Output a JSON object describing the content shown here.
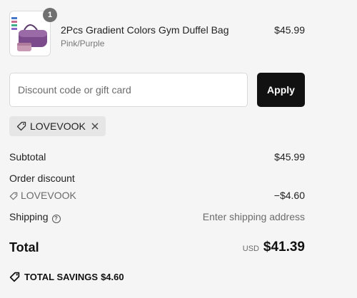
{
  "cart": {
    "item": {
      "quantity": "1",
      "name": "2Pcs Gradient Colors Gym Duffel Bag",
      "variant": "Pink/Purple",
      "price": "$45.99"
    }
  },
  "discount_form": {
    "placeholder": "Discount code or gift card",
    "apply_label": "Apply"
  },
  "applied_code": {
    "code": "LOVEVOOK"
  },
  "summary": {
    "subtotal_label": "Subtotal",
    "subtotal_value": "$45.99",
    "order_discount_label": "Order discount",
    "discount_code": "LOVEVOOK",
    "discount_value": "−$4.60",
    "shipping_label": "Shipping",
    "shipping_value": "Enter shipping address",
    "total_label": "Total",
    "currency": "USD",
    "total_value": "$41.39",
    "savings_label": "TOTAL SAVINGS",
    "savings_value": "$4.60"
  },
  "icons": {
    "tag": "tag-icon",
    "close": "close-icon",
    "help": "help-icon"
  },
  "colors": {
    "background": "#f5f5f5",
    "button": "#111111",
    "badge": "#707070",
    "muted_text": "#6b6b6b"
  }
}
